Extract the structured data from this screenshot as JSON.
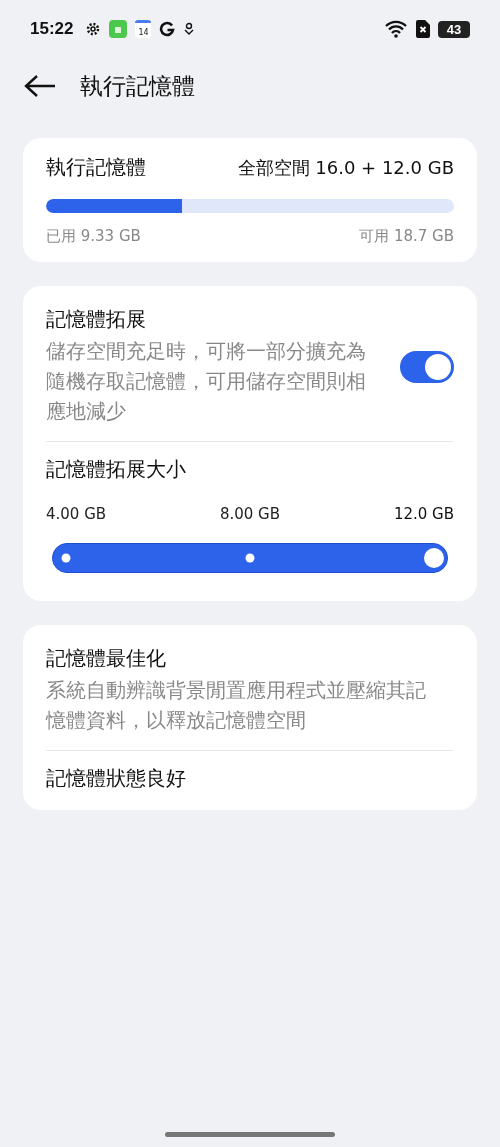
{
  "status_bar": {
    "time": "15:22",
    "calendar_day": "14",
    "battery": "43"
  },
  "header": {
    "title": "執行記憶體"
  },
  "ram_card": {
    "title": "執行記憶體",
    "total": "全部空間 16.0 + 12.0 GB",
    "level": 0.333,
    "used": "已用 9.33 GB",
    "available": "可用 18.7 GB"
  },
  "expansion_card": {
    "title": "記憶體拓展",
    "description": "儲存空間充足時，可將一部分擴充為隨機存取記憶體，可用儲存空間則相應地減少",
    "on": true,
    "size_title": "記憶體拓展大小",
    "size_options": [
      {
        "label": "4.00 GB",
        "selected": false
      },
      {
        "label": "8.00 GB",
        "selected": false
      },
      {
        "label": "12.0 GB",
        "selected": true
      }
    ],
    "level": 1
  },
  "optimization_card": {
    "title": "記憶體最佳化",
    "description": "系統自動辨識背景閒置應用程式並壓縮其記憶體資料，以釋放記憶體空間",
    "status": "記憶體狀態良好"
  }
}
